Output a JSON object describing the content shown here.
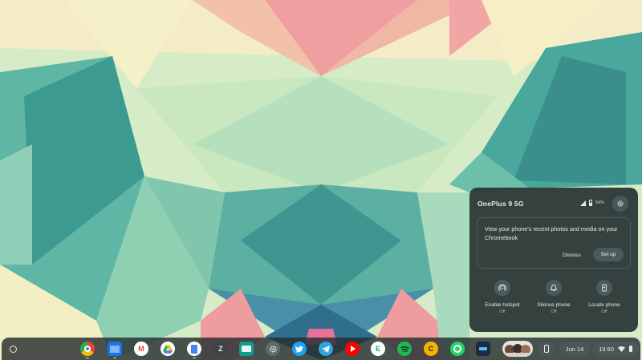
{
  "phone_hub": {
    "device_name": "OnePlus 9 5G",
    "battery": "54%",
    "icons": [
      "signal-icon",
      "battery-icon",
      "gear-icon"
    ],
    "recent_media_card": {
      "message": "View your phone's recent photos and media on your Chromebook",
      "dismiss_label": "Dismiss",
      "setup_label": "Set up"
    },
    "quick_actions": [
      {
        "label": "Enable hotspot",
        "state": "Off",
        "icon": "hotspot-icon"
      },
      {
        "label": "Silence phone",
        "state": "Off",
        "icon": "bell-icon"
      },
      {
        "label": "Locate phone",
        "state": "Off",
        "icon": "phone-locate-icon"
      }
    ]
  },
  "shelf": {
    "apps": [
      {
        "name": "chrome",
        "glyph": ""
      },
      {
        "name": "files",
        "glyph": ""
      },
      {
        "name": "gmail",
        "glyph": "M"
      },
      {
        "name": "google-drive",
        "glyph": ""
      },
      {
        "name": "google-docs",
        "glyph": ""
      },
      {
        "name": "zoom-z",
        "glyph": "Z"
      },
      {
        "name": "app-card",
        "glyph": ""
      },
      {
        "name": "settings",
        "glyph": ""
      },
      {
        "name": "twitter",
        "glyph": ""
      },
      {
        "name": "telegram",
        "glyph": ""
      },
      {
        "name": "youtube",
        "glyph": ""
      },
      {
        "name": "e-app",
        "glyph": "E"
      },
      {
        "name": "spotify",
        "glyph": ""
      },
      {
        "name": "c-app",
        "glyph": "C"
      },
      {
        "name": "whatsapp",
        "glyph": ""
      },
      {
        "name": "dark-app",
        "glyph": ""
      }
    ],
    "date": "Jun 14",
    "time": "19:50",
    "tray_icons": [
      "wifi-icon",
      "battery-icon"
    ]
  },
  "colors": {
    "hub_bg": "#283434",
    "shelf_bg": "#262e30",
    "button_bg": "#4b5a5c"
  }
}
